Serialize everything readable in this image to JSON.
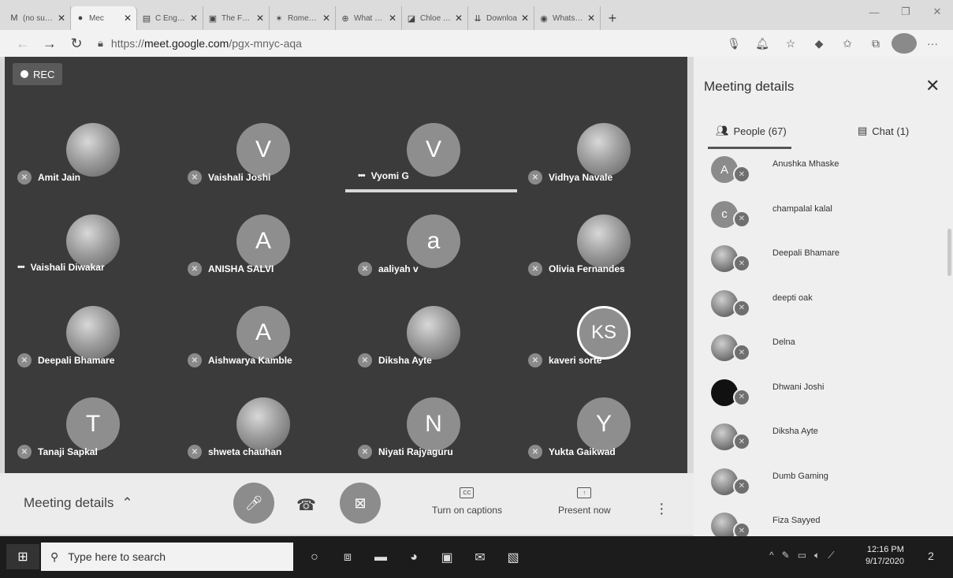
{
  "browser": {
    "tabs": [
      {
        "icon": "gmail-icon",
        "glyph": "M",
        "label": "(no subje",
        "active": false
      },
      {
        "icon": "meet-icon",
        "glyph": "●",
        "label": "Mec",
        "active": true
      },
      {
        "icon": "docs-icon",
        "glyph": "▤",
        "label": "C Eng. A",
        "active": false
      },
      {
        "icon": "doc-icon",
        "glyph": "▣",
        "label": "The Frog",
        "active": false
      },
      {
        "icon": "page-icon",
        "glyph": "✶",
        "label": "Romeo ar",
        "active": false
      },
      {
        "icon": "globe-icon",
        "glyph": "⊕",
        "label": "What Wo",
        "active": false
      },
      {
        "icon": "reader-icon",
        "glyph": "◪",
        "label": "Chloe Th",
        "active": false
      },
      {
        "icon": "download-icon",
        "glyph": "⇊",
        "label": "Downloa",
        "active": false
      },
      {
        "icon": "whatsapp-icon",
        "glyph": "◉",
        "label": "WhatsAp",
        "active": false
      }
    ],
    "new_tab": "+",
    "url_prefix": "https://",
    "url_host": "meet.google.com",
    "url_path": "/pgx-mnyc-aqa"
  },
  "meeting": {
    "rec_label": "REC",
    "participants": [
      {
        "name": "Amit Jain",
        "initial": "",
        "photo": true,
        "status": "mic-off"
      },
      {
        "name": "Vaishali Joshi",
        "initial": "V",
        "photo": false,
        "status": "mic-off"
      },
      {
        "name": "Vyomi G",
        "initial": "V",
        "photo": false,
        "status": "more"
      },
      {
        "name": "Vidhya Navale",
        "initial": "",
        "photo": true,
        "status": "mic-off"
      },
      {
        "name": "Vaishali Diwakar",
        "initial": "",
        "photo": true,
        "status": "more"
      },
      {
        "name": "ANISHA SALVI",
        "initial": "A",
        "photo": false,
        "status": "mic-off"
      },
      {
        "name": "aaliyah v",
        "initial": "a",
        "photo": false,
        "status": "mic-off"
      },
      {
        "name": "Olivia Fernandes",
        "initial": "",
        "photo": true,
        "status": "mic-off"
      },
      {
        "name": "Deepali Bhamare",
        "initial": "",
        "photo": true,
        "status": "mic-off"
      },
      {
        "name": "Aishwarya Kamble",
        "initial": "A",
        "photo": false,
        "status": "mic-off"
      },
      {
        "name": "Diksha Ayte",
        "initial": "",
        "photo": true,
        "status": "mic-off"
      },
      {
        "name": "kaveri sorte",
        "initial": "KS",
        "photo": false,
        "status": "mic-off"
      },
      {
        "name": "Tanaji Sapkal",
        "initial": "T",
        "photo": false,
        "status": "mic-off"
      },
      {
        "name": "shweta chauhan",
        "initial": "",
        "photo": true,
        "status": "mic-off"
      },
      {
        "name": "Niyati Rajyaguru",
        "initial": "N",
        "photo": false,
        "status": "mic-off"
      },
      {
        "name": "Yukta Gaikwad",
        "initial": "Y",
        "photo": false,
        "status": "mic-off"
      }
    ]
  },
  "controls": {
    "meeting_details": "Meeting details",
    "captions": "Turn on captions",
    "captions_icon_text": "CC",
    "present": "Present now"
  },
  "panel": {
    "title": "Meeting details",
    "people_tab": "People (67)",
    "chat_tab": "Chat (1)",
    "people": [
      {
        "name": "Anushka Mhaske",
        "initial": "A",
        "avatar": "letter"
      },
      {
        "name": "champalal kalal",
        "initial": "c",
        "avatar": "letter"
      },
      {
        "name": "Deepali Bhamare",
        "initial": "",
        "avatar": "photo"
      },
      {
        "name": "deepti oak",
        "initial": "",
        "avatar": "photo"
      },
      {
        "name": "Delna",
        "initial": "",
        "avatar": "photo"
      },
      {
        "name": "Dhwani Joshi",
        "initial": "",
        "avatar": "dark"
      },
      {
        "name": "Diksha Ayte",
        "initial": "",
        "avatar": "photo"
      },
      {
        "name": "Dumb Gaming",
        "initial": "",
        "avatar": "photo"
      },
      {
        "name": "Fiza Sayyed",
        "initial": "",
        "avatar": "photo"
      }
    ]
  },
  "taskbar": {
    "search_placeholder": "Type here to search",
    "time": "12:16 PM",
    "date": "9/17/2020",
    "notification_count": "2"
  }
}
